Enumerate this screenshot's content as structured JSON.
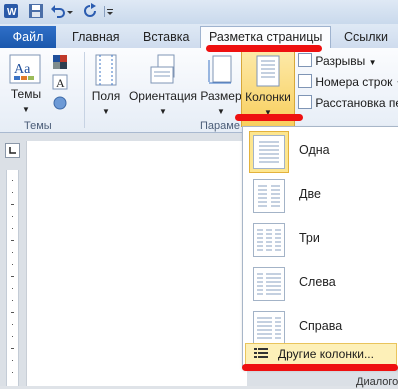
{
  "qat": {
    "undo_hint": "",
    "icons": [
      "word-logo-icon",
      "save-icon",
      "undo-icon",
      "redo-icon",
      "customize-icon"
    ]
  },
  "tabs": {
    "file": "Файл",
    "home": "Главная",
    "insert": "Вставка",
    "page_layout": "Разметка страницы",
    "references": "Ссылки"
  },
  "ribbon": {
    "themes_group": {
      "themes_button": "Темы",
      "group_label": "Темы"
    },
    "page_setup": {
      "margins": "Поля",
      "orientation": "Ориентация",
      "size": "Размер",
      "columns": "Колонки",
      "breaks": "Разрывы",
      "line_numbers": "Номера строк",
      "hyphenation": "Расстановка пер",
      "group_label": "Параме"
    }
  },
  "columns_menu": {
    "items": [
      {
        "label": "Одна",
        "selected": true
      },
      {
        "label": "Две",
        "selected": false
      },
      {
        "label": "Три",
        "selected": false
      },
      {
        "label": "Слева",
        "selected": false
      },
      {
        "label": "Справа",
        "selected": false
      }
    ],
    "more": "Другие колонки..."
  },
  "right_pane_text": "Диалогов",
  "colors": {
    "file_tab": "#1b58ad",
    "highlight": "#fde68f",
    "annotation": "#ee1010"
  }
}
